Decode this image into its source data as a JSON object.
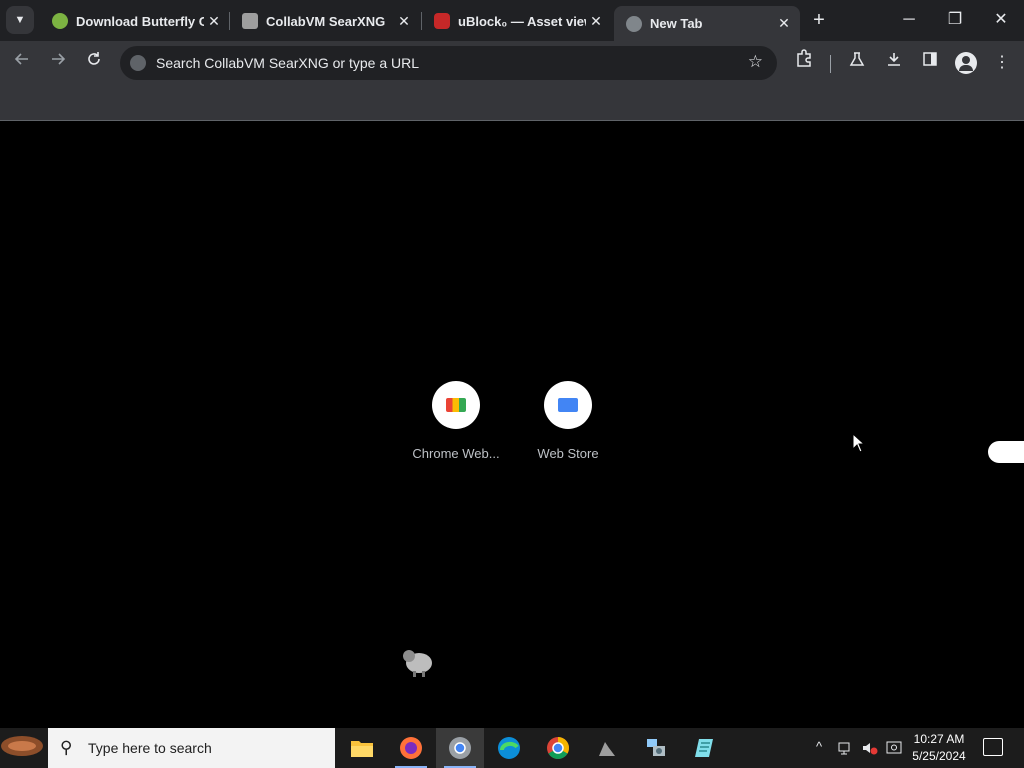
{
  "browser": {
    "tabs": [
      {
        "title": "Download Butterfly O",
        "favicon": "butterfly-favicon",
        "active": false
      },
      {
        "title": "CollabVM SearXNG",
        "favicon": "searxng-favicon",
        "active": false
      },
      {
        "title": "uBlock₀ — Asset view",
        "favicon": "ublock-favicon",
        "active": false
      },
      {
        "title": "New Tab",
        "favicon": "globe-favicon",
        "active": true
      }
    ],
    "close_glyph": "✕",
    "new_tab_glyph": "+",
    "window_controls": {
      "minimize": "─",
      "restore": "❐",
      "close": "✕"
    },
    "omnibox": {
      "placeholder": "Search CollabVM SearXNG or type a URL"
    }
  },
  "new_tab": {
    "shortcuts": [
      {
        "label": "Chrome Web...",
        "icon": "chrome-web-store-icon"
      },
      {
        "label": "Web Store",
        "icon": "web-store-icon"
      }
    ]
  },
  "taskbar": {
    "search_placeholder": "Type here to search",
    "apps": [
      "file-explorer",
      "firefox",
      "chrome",
      "edge",
      "chrome-alt",
      "app-generic",
      "network-tool",
      "notepad-like"
    ],
    "clock": {
      "time": "10:27 AM",
      "date": "5/25/2024"
    }
  },
  "colors": {
    "tab_strip": "#202124",
    "toolbar": "#35363a",
    "accent": "#8ab4f8"
  }
}
